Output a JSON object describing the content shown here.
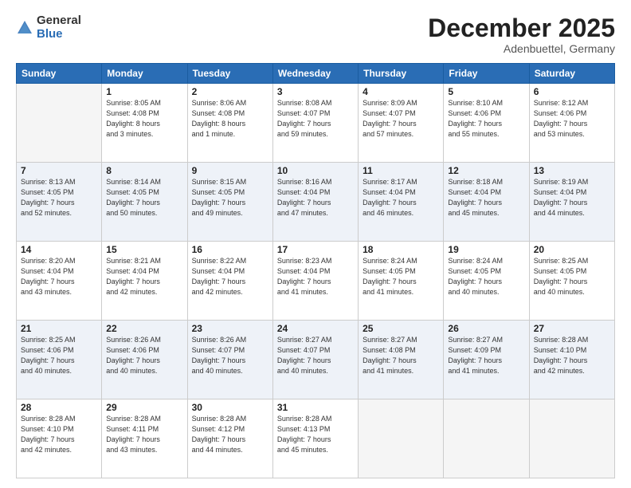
{
  "logo": {
    "general": "General",
    "blue": "Blue"
  },
  "header": {
    "month": "December 2025",
    "location": "Adenbuettel, Germany"
  },
  "weekdays": [
    "Sunday",
    "Monday",
    "Tuesday",
    "Wednesday",
    "Thursday",
    "Friday",
    "Saturday"
  ],
  "weeks": [
    [
      {
        "day": "",
        "info": ""
      },
      {
        "day": "1",
        "info": "Sunrise: 8:05 AM\nSunset: 4:08 PM\nDaylight: 8 hours\nand 3 minutes."
      },
      {
        "day": "2",
        "info": "Sunrise: 8:06 AM\nSunset: 4:08 PM\nDaylight: 8 hours\nand 1 minute."
      },
      {
        "day": "3",
        "info": "Sunrise: 8:08 AM\nSunset: 4:07 PM\nDaylight: 7 hours\nand 59 minutes."
      },
      {
        "day": "4",
        "info": "Sunrise: 8:09 AM\nSunset: 4:07 PM\nDaylight: 7 hours\nand 57 minutes."
      },
      {
        "day": "5",
        "info": "Sunrise: 8:10 AM\nSunset: 4:06 PM\nDaylight: 7 hours\nand 55 minutes."
      },
      {
        "day": "6",
        "info": "Sunrise: 8:12 AM\nSunset: 4:06 PM\nDaylight: 7 hours\nand 53 minutes."
      }
    ],
    [
      {
        "day": "7",
        "info": "Sunrise: 8:13 AM\nSunset: 4:05 PM\nDaylight: 7 hours\nand 52 minutes."
      },
      {
        "day": "8",
        "info": "Sunrise: 8:14 AM\nSunset: 4:05 PM\nDaylight: 7 hours\nand 50 minutes."
      },
      {
        "day": "9",
        "info": "Sunrise: 8:15 AM\nSunset: 4:05 PM\nDaylight: 7 hours\nand 49 minutes."
      },
      {
        "day": "10",
        "info": "Sunrise: 8:16 AM\nSunset: 4:04 PM\nDaylight: 7 hours\nand 47 minutes."
      },
      {
        "day": "11",
        "info": "Sunrise: 8:17 AM\nSunset: 4:04 PM\nDaylight: 7 hours\nand 46 minutes."
      },
      {
        "day": "12",
        "info": "Sunrise: 8:18 AM\nSunset: 4:04 PM\nDaylight: 7 hours\nand 45 minutes."
      },
      {
        "day": "13",
        "info": "Sunrise: 8:19 AM\nSunset: 4:04 PM\nDaylight: 7 hours\nand 44 minutes."
      }
    ],
    [
      {
        "day": "14",
        "info": "Sunrise: 8:20 AM\nSunset: 4:04 PM\nDaylight: 7 hours\nand 43 minutes."
      },
      {
        "day": "15",
        "info": "Sunrise: 8:21 AM\nSunset: 4:04 PM\nDaylight: 7 hours\nand 42 minutes."
      },
      {
        "day": "16",
        "info": "Sunrise: 8:22 AM\nSunset: 4:04 PM\nDaylight: 7 hours\nand 42 minutes."
      },
      {
        "day": "17",
        "info": "Sunrise: 8:23 AM\nSunset: 4:04 PM\nDaylight: 7 hours\nand 41 minutes."
      },
      {
        "day": "18",
        "info": "Sunrise: 8:24 AM\nSunset: 4:05 PM\nDaylight: 7 hours\nand 41 minutes."
      },
      {
        "day": "19",
        "info": "Sunrise: 8:24 AM\nSunset: 4:05 PM\nDaylight: 7 hours\nand 40 minutes."
      },
      {
        "day": "20",
        "info": "Sunrise: 8:25 AM\nSunset: 4:05 PM\nDaylight: 7 hours\nand 40 minutes."
      }
    ],
    [
      {
        "day": "21",
        "info": "Sunrise: 8:25 AM\nSunset: 4:06 PM\nDaylight: 7 hours\nand 40 minutes."
      },
      {
        "day": "22",
        "info": "Sunrise: 8:26 AM\nSunset: 4:06 PM\nDaylight: 7 hours\nand 40 minutes."
      },
      {
        "day": "23",
        "info": "Sunrise: 8:26 AM\nSunset: 4:07 PM\nDaylight: 7 hours\nand 40 minutes."
      },
      {
        "day": "24",
        "info": "Sunrise: 8:27 AM\nSunset: 4:07 PM\nDaylight: 7 hours\nand 40 minutes."
      },
      {
        "day": "25",
        "info": "Sunrise: 8:27 AM\nSunset: 4:08 PM\nDaylight: 7 hours\nand 41 minutes."
      },
      {
        "day": "26",
        "info": "Sunrise: 8:27 AM\nSunset: 4:09 PM\nDaylight: 7 hours\nand 41 minutes."
      },
      {
        "day": "27",
        "info": "Sunrise: 8:28 AM\nSunset: 4:10 PM\nDaylight: 7 hours\nand 42 minutes."
      }
    ],
    [
      {
        "day": "28",
        "info": "Sunrise: 8:28 AM\nSunset: 4:10 PM\nDaylight: 7 hours\nand 42 minutes."
      },
      {
        "day": "29",
        "info": "Sunrise: 8:28 AM\nSunset: 4:11 PM\nDaylight: 7 hours\nand 43 minutes."
      },
      {
        "day": "30",
        "info": "Sunrise: 8:28 AM\nSunset: 4:12 PM\nDaylight: 7 hours\nand 44 minutes."
      },
      {
        "day": "31",
        "info": "Sunrise: 8:28 AM\nSunset: 4:13 PM\nDaylight: 7 hours\nand 45 minutes."
      },
      {
        "day": "",
        "info": ""
      },
      {
        "day": "",
        "info": ""
      },
      {
        "day": "",
        "info": ""
      }
    ]
  ]
}
